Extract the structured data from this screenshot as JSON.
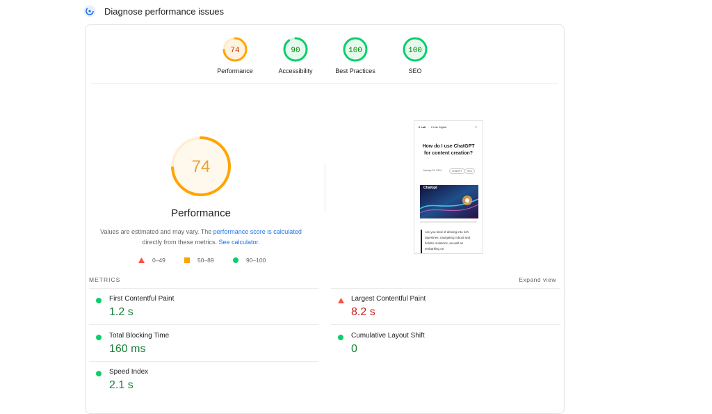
{
  "header": {
    "title": "Diagnose performance issues",
    "icon": "lighthouse-gauge-icon"
  },
  "colors": {
    "pass": "#0cce6b",
    "average": "#ffa400",
    "fail": "#ff4e42",
    "link": "#1a73e8",
    "fail_text": "#c5221f",
    "pass_text": "#188038"
  },
  "categories": [
    {
      "label": "Performance",
      "score": "74",
      "status": "average"
    },
    {
      "label": "Accessibility",
      "score": "90",
      "status": "pass"
    },
    {
      "label": "Best Practices",
      "score": "100",
      "status": "pass"
    },
    {
      "label": "SEO",
      "score": "100",
      "status": "pass"
    }
  ],
  "performance": {
    "score": "74",
    "title": "Performance",
    "note": {
      "prefix": "Values are estimated and may vary. The ",
      "link1": "performance score is calculated",
      "middle": " directly from these metrics. ",
      "link2": "See calculator."
    }
  },
  "legend": [
    {
      "range": "0–49",
      "shape": "triangle"
    },
    {
      "range": "50–89",
      "shape": "square"
    },
    {
      "range": "90–100",
      "shape": "circle"
    }
  ],
  "screenshot": {
    "logo": "Ii Lab",
    "brand": "Ii Lab Digital",
    "menu": "≡",
    "title": "How do I use ChatGPT for content creation?",
    "date": "January 03, 2024",
    "tags": [
      "ChatGPT",
      "SEO"
    ],
    "image_text": "ChatGpt",
    "body": "Are you tired of delving into rich tapestries, navigating robust and holistic solutions, as well as embarking on"
  },
  "metrics": {
    "label": "METRICS",
    "expand_label": "Expand view",
    "items": [
      {
        "name": "First Contentful Paint",
        "value": "1.2 s",
        "status": "pass"
      },
      {
        "name": "Largest Contentful Paint",
        "value": "8.2 s",
        "status": "fail"
      },
      {
        "name": "Total Blocking Time",
        "value": "160 ms",
        "status": "pass"
      },
      {
        "name": "Cumulative Layout Shift",
        "value": "0",
        "status": "pass"
      },
      {
        "name": "Speed Index",
        "value": "2.1 s",
        "status": "pass"
      }
    ]
  }
}
